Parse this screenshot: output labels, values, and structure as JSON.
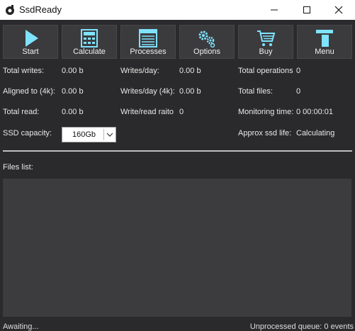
{
  "window": {
    "title": "SsdReady"
  },
  "toolbar": {
    "start": "Start",
    "calculate": "Calculate",
    "processes": "Processes",
    "options": "Options",
    "buy": "Buy",
    "menu": "Menu"
  },
  "stats": {
    "total_writes_label": "Total writes:",
    "total_writes_value": "0.00 b",
    "aligned_label": "Aligned to (4k):",
    "aligned_value": "0.00 b",
    "total_read_label": "Total read:",
    "total_read_value": "0.00 b",
    "ssd_capacity_label": "SSD capacity:",
    "writes_day_label": "Writes/day:",
    "writes_day_value": "0.00 b",
    "writes_day_4k_label": "Writes/day (4k):",
    "writes_day_4k_value": "0.00 b",
    "write_read_ratio_label": "Write/read raito",
    "write_read_ratio_value": "0",
    "total_operations_label": "Total operations",
    "total_operations_value": "0",
    "total_files_label": "Total files:",
    "total_files_value": "0",
    "monitoring_time_label": "Monitoring time:",
    "monitoring_time_value": "0 00:00:01",
    "approx_life_label": "Approx ssd life:",
    "approx_life_value": "Calculating"
  },
  "ssd_capacity": {
    "selected": "160Gb"
  },
  "files_list": {
    "label": "Files list:"
  },
  "status": {
    "left": "Awaiting...",
    "right": "Unprocessed queue: 0 events"
  },
  "colors": {
    "background": "#2a2a2c",
    "button": "#3b3b3e",
    "icon_accent": "#7fe3ff",
    "list_bg": "#3c3c3e"
  }
}
